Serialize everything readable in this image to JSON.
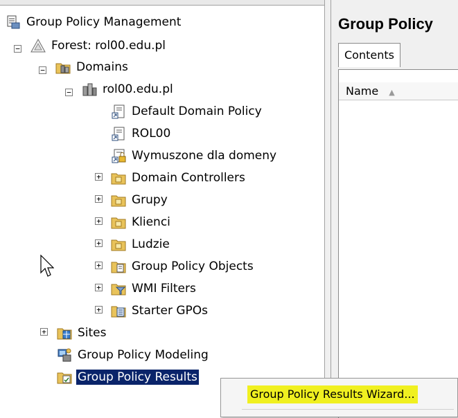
{
  "tree": {
    "root": "Group Policy Management",
    "forest": "Forest: rol00.edu.pl",
    "domains": "Domains",
    "domain": "rol00.edu.pl",
    "items": [
      "Default Domain Policy",
      "ROL00",
      "Wymuszone dla domeny",
      "Domain Controllers",
      "Grupy",
      "Klienci",
      "Ludzie",
      "Group Policy Objects",
      "WMI Filters",
      "Starter GPOs"
    ],
    "sites": "Sites",
    "modeling": "Group Policy Modeling",
    "results": "Group Policy Results",
    "expand_plus": "+",
    "expand_minus": "−"
  },
  "right_pane": {
    "title": "Group Policy",
    "tab_contents": "Contents",
    "col_name": "Name",
    "sort_glyph": "▲"
  },
  "context_menu": {
    "item": "Group Policy Results Wizard..."
  },
  "colors": {
    "selection": "#0a246a",
    "highlight": "#f0f020"
  }
}
